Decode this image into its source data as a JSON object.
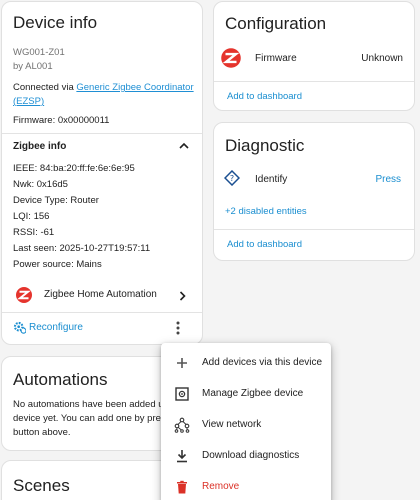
{
  "device_card": {
    "title": "Device info",
    "model": "WG001-Z01",
    "manufacturer": "by AL001",
    "connected_prefix": "Connected via ",
    "connected_link_line1": "Generic Zigbee Coordinator",
    "connected_link_line2": "(EZSP)",
    "firmware": "Firmware: 0x00000011",
    "zigbee_info_title": "Zigbee info",
    "zigbee_info": [
      "IEEE: 84:ba:20:ff:fe:6e:6e:95",
      "Nwk: 0x16d5",
      "Device Type: Router",
      "LQI: 156",
      "RSSI: -61",
      "Last seen: 2025-10-27T19:57:11",
      "Power source: Mains"
    ],
    "integration_label": "Zigbee Home Automation",
    "reconfigure_label": "Reconfigure"
  },
  "config_card": {
    "title": "Configuration",
    "firmware_label": "Firmware",
    "firmware_value": "Unknown",
    "add_to_dashboard": "Add to dashboard"
  },
  "diagnostic_card": {
    "title": "Diagnostic",
    "identify_label": "Identify",
    "identify_action": "Press",
    "disabled_entities": "+2 disabled entities",
    "add_to_dashboard": "Add to dashboard"
  },
  "automations_card": {
    "title": "Automations",
    "text_line1": "No automations have been added usi",
    "text_line2": "device yet. You can add one by pressi",
    "text_line3": "button above."
  },
  "scenes_card": {
    "title": "Scenes"
  },
  "menu": {
    "items": [
      {
        "label": "Add devices via this device",
        "icon": "plus-icon"
      },
      {
        "label": "Manage Zigbee device",
        "icon": "manage-device-icon"
      },
      {
        "label": "View network",
        "icon": "network-icon"
      },
      {
        "label": "Download diagnostics",
        "icon": "download-icon"
      },
      {
        "label": "Remove",
        "icon": "trash-icon"
      }
    ]
  },
  "colors": {
    "link": "#1f8fd4",
    "zigbee_red": "#e5342d",
    "remove_red": "#db3127"
  }
}
